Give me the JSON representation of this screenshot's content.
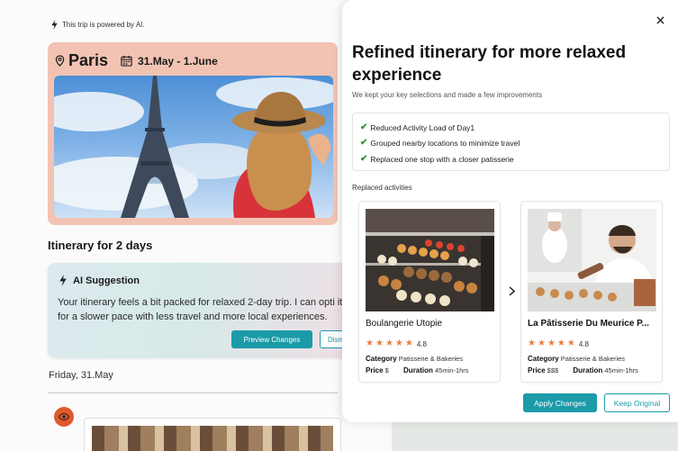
{
  "background": {
    "powered_by": "This trip is powered by AI.",
    "trip": {
      "city": "Paris",
      "dates": "31.May - 1.June"
    },
    "itinerary_title": "Itinerary for 2 days",
    "ai_suggestion": {
      "title": "AI Suggestion",
      "body": "Your itinerary feels a bit packed for relaxed 2-day trip. I can opti it for a slower pace with less travel and more local experiences.",
      "preview_label": "Preview Changes",
      "dismiss_label": "Dism"
    },
    "day_label": "Friday, 31.May"
  },
  "modal": {
    "title": "Refined itinerary for more relaxed experience",
    "subtitle": "We kept your key selections and made a few improvements",
    "improvements": [
      "Reduced Activity Load of Day1",
      "Grouped nearby locations to minimize travel",
      "Replaced one stop with a closer patisserie"
    ],
    "replaced_title": "Replaced activities",
    "activities": [
      {
        "name": "Boulangerie Utopie",
        "rating": "4.8",
        "stars": 5,
        "category_label": "Category",
        "category": "Patisserie & Bakeries",
        "price_label": "Price",
        "price": "$",
        "duration_label": "Duration",
        "duration": "45min-1hrs"
      },
      {
        "name": "La Pâtisserie Du Meurice P...",
        "rating": "4.8",
        "stars": 5,
        "category_label": "Category",
        "category": "Patisserie & Bakeries",
        "price_label": "Price",
        "price": "$$$",
        "duration_label": "Duration",
        "duration": "45min-1hrs"
      }
    ],
    "apply_label": "Apply Changes",
    "keep_label": "Keep Original"
  },
  "colors": {
    "accent": "#1b9aa8",
    "star": "#ef7d3c",
    "check": "#2d9a2d",
    "trip_card": "#f2c3b3",
    "eye_badge": "#e05a2a"
  },
  "icons": [
    "lightning-icon",
    "location-pin-icon",
    "calendar-icon",
    "close-icon",
    "check-icon",
    "star-icon",
    "chevron-right-icon",
    "eye-icon"
  ]
}
